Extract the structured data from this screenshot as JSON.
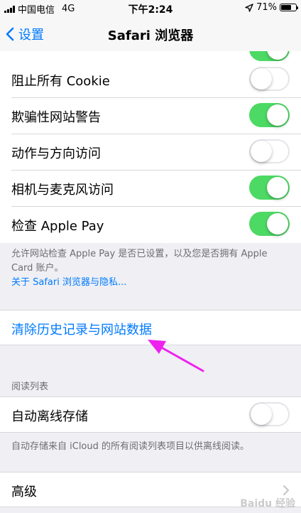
{
  "status_bar": {
    "carrier": "中国电信",
    "network": "4G",
    "time": "下午2:24",
    "battery_percent_label": "71%",
    "battery_level": 0.71
  },
  "nav": {
    "back_label": "设置",
    "title": "Safari 浏览器"
  },
  "settings": [
    {
      "label": "阻止所有 Cookie",
      "enabled": false
    },
    {
      "label": "欺骗性网站警告",
      "enabled": true
    },
    {
      "label": "动作与方向访问",
      "enabled": false
    },
    {
      "label": "相机与麦克风访问",
      "enabled": true
    },
    {
      "label": "检查 Apple Pay",
      "enabled": true
    }
  ],
  "apple_pay_note": {
    "text": "允许网站检查 Apple Pay 是否已设置，以及您是否拥有 Apple Card 账户。",
    "link": "关于 Safari 浏览器与隐私..."
  },
  "clear_history": {
    "label": "清除历史记录与网站数据"
  },
  "reading_list": {
    "header": "阅读列表",
    "offline_label": "自动离线存储",
    "offline_enabled": false,
    "note": "自动存储来自 iCloud 的所有阅读列表项目以供离线阅读。"
  },
  "advanced": {
    "label": "高级"
  },
  "watermark": "Baidu 经验",
  "colors": {
    "ios_blue": "#007aff",
    "toggle_on": "#4cd964",
    "annotation_arrow": "#ee22ee"
  }
}
